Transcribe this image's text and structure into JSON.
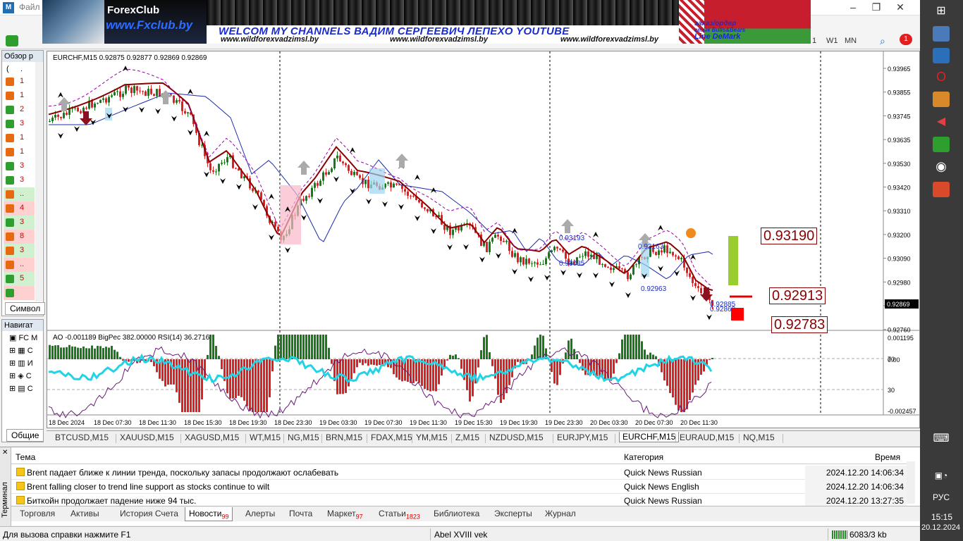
{
  "window": {
    "menu_file": "Файл",
    "tf_1": "1",
    "tf_w1": "W1",
    "tf_mn": "MN",
    "notif_count": "1"
  },
  "banner": {
    "forex": "ForexClub",
    "fxclub": "www.Fxclub.by",
    "welcome": "WELCOM MY CHANNELS ВАДИМ СЕРГЕЕВИЧ ЛЕПЕХО YOUTUBE",
    "site1": "www.wildforexvadzimsl.by",
    "site2": "www.wildforexvadzimsl.by",
    "site3": "www.wildforexvadzimsl.by",
    "order": "заказ/ордер",
    "order2": "стык Bulls&Bears",
    "demark": "Line DeMark"
  },
  "market_watch": {
    "title": "Обзор р",
    "header_cols": [
      "(",
      "."
    ],
    "rows": [
      {
        "value": "1",
        "dir": "down"
      },
      {
        "value": "1",
        "dir": "down"
      },
      {
        "value": "2",
        "dir": "up"
      },
      {
        "value": "3",
        "dir": "up"
      },
      {
        "value": "1",
        "dir": "down"
      },
      {
        "value": "1",
        "dir": "down"
      },
      {
        "value": "3",
        "dir": "up"
      },
      {
        "value": "3",
        "dir": "up"
      },
      {
        "value": "..",
        "dir": "down"
      },
      {
        "value": "4",
        "dir": "down"
      },
      {
        "value": "3",
        "dir": "up"
      },
      {
        "value": "8",
        "dir": "down"
      },
      {
        "value": "3",
        "dir": "down"
      },
      {
        "value": "..",
        "dir": "down"
      },
      {
        "value": "5",
        "dir": "up"
      },
      {
        "value": "",
        "dir": "up"
      }
    ],
    "tab": "Символ"
  },
  "navigator": {
    "title": "Навигат",
    "items": [
      "FC M",
      "С",
      "И",
      "С",
      "С"
    ],
    "tab": "Общие"
  },
  "chart": {
    "info": "EURCHF,M15  0.92875 0.92877 0.92869 0.92869",
    "indicator_info": "AO -0.001189  BigPec 382.00000  RSI(14) 36.2716",
    "price_axis": [
      "0.93965",
      "0.93855",
      "0.93745",
      "0.93635",
      "0.93530",
      "0.93420",
      "0.93310",
      "0.93200",
      "0.93090",
      "0.92980",
      "0.92869",
      "0.92760"
    ],
    "current_price": "0.92869",
    "ind_axis": [
      "0.001195",
      "70",
      "0.00",
      "30",
      "-0.002457"
    ],
    "time_axis": [
      "18 Dec 2024",
      "18 Dec 07:30",
      "18 Dec 11:30",
      "18 Dec 15:30",
      "18 Dec 19:30",
      "18 Dec 23:30",
      "19 Dec 03:30",
      "19 Dec 07:30",
      "19 Dec 11:30",
      "19 Dec 15:30",
      "19 Dec 19:30",
      "19 Dec 23:30",
      "20 Dec 03:30",
      "20 Dec 07:30",
      "20 Dec 11:30"
    ],
    "levels": {
      "high": "0.93190",
      "mid": "0.92913",
      "low": "0.92783"
    },
    "annotations": [
      "0.93193",
      "0.93085",
      "0.93163",
      "0.92963",
      "0.92885",
      "0.92869"
    ]
  },
  "symbol_tabs": [
    "BTCUSD,M15",
    "XAUUSD,M15",
    "XAGUSD,M15",
    "WT,M15",
    "NG,M15",
    "BRN,M15",
    "FDAX,M15",
    "YM,M15",
    "Z,M15",
    "NZDUSD,M15",
    "EURJPY,M15",
    "EURCHF,M15",
    "EURAUD,M15",
    "NQ,M15"
  ],
  "active_symbol_tab": "EURCHF,M15",
  "terminal": {
    "side_label": "Терминал",
    "headers": {
      "topic": "Тема",
      "category": "Категория",
      "time": "Время"
    },
    "news": [
      {
        "title": "Brent падает ближе к линии тренда, поскольку запасы продолжают ослабевать",
        "category": "Quick News Russian",
        "time": "2024.12.20 14:06:34"
      },
      {
        "title": "Brent falling closer to trend line support as stocks continue to wilt",
        "category": "Quick News English",
        "time": "2024.12.20 14:06:34"
      },
      {
        "title": "Биткойн продолжает падение ниже 94 тыс.",
        "category": "Quick News Russian",
        "time": "2024.12.20 13:27:35"
      }
    ],
    "tabs": [
      {
        "label": "Торговля",
        "badge": ""
      },
      {
        "label": "Активы",
        "badge": ""
      },
      {
        "label": "История Счета",
        "badge": ""
      },
      {
        "label": "Новости",
        "badge": "99"
      },
      {
        "label": "Алерты",
        "badge": ""
      },
      {
        "label": "Почта",
        "badge": ""
      },
      {
        "label": "Маркет",
        "badge": "97"
      },
      {
        "label": "Статьи",
        "badge": "1823"
      },
      {
        "label": "Библиотека",
        "badge": ""
      },
      {
        "label": "Эксперты",
        "badge": ""
      },
      {
        "label": "Журнал",
        "badge": ""
      }
    ]
  },
  "status": {
    "help": "Для вызова справки нажмите F1",
    "profile": "Abel XVIII vek",
    "traffic": "6083/3 kb"
  },
  "taskbar": {
    "lang": "РУС",
    "time": "15:15",
    "date": "20.12.2024"
  },
  "colors": {
    "bull": "#1a7a1a",
    "bear": "#e02020",
    "rsi": "#22d3e6",
    "ma": "#1a2bb0",
    "level": "#8b0000"
  }
}
